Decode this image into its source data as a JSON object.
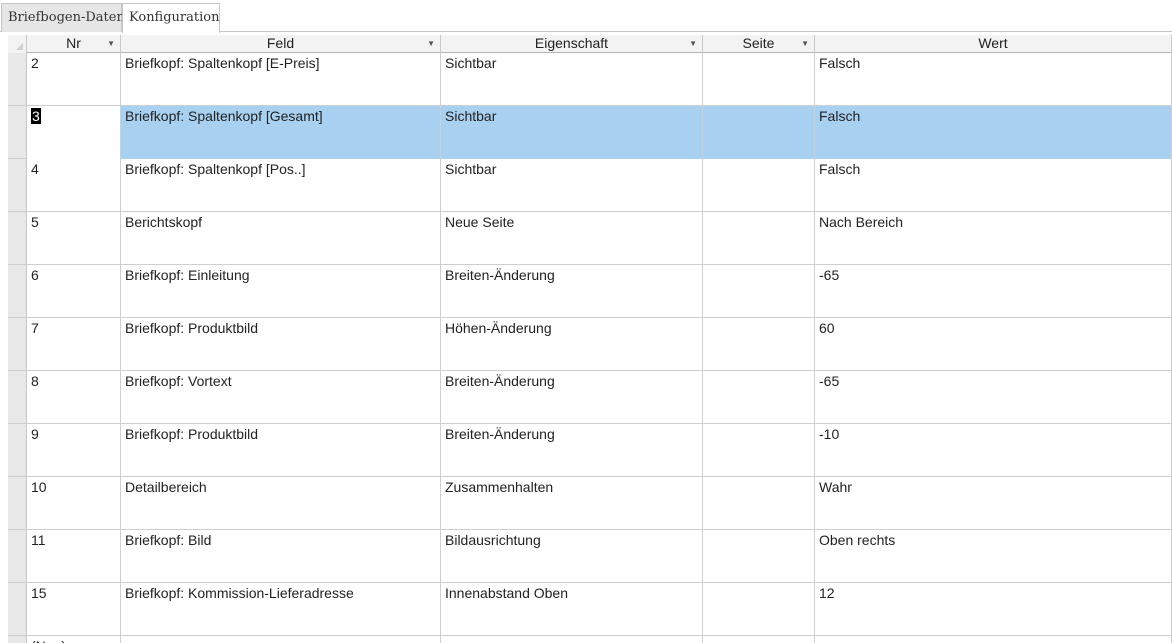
{
  "tabs": [
    {
      "label": "Briefbogen-Daten",
      "active": false
    },
    {
      "label": "Konfiguration",
      "active": true
    }
  ],
  "columns": {
    "nr": "Nr",
    "feld": "Feld",
    "eigenschaft": "Eigenschaft",
    "seite": "Seite",
    "wert": "Wert"
  },
  "rows": [
    {
      "nr": "2",
      "feld": "Briefkopf: Spaltenkopf [E-Preis]",
      "eigenschaft": "Sichtbar",
      "seite": "",
      "wert": "Falsch"
    },
    {
      "nr": "3",
      "feld": "Briefkopf: Spaltenkopf [Gesamt]",
      "eigenschaft": "Sichtbar",
      "seite": "",
      "wert": "Falsch",
      "selected": true
    },
    {
      "nr": "4",
      "feld": "Briefkopf: Spaltenkopf [Pos..]",
      "eigenschaft": "Sichtbar",
      "seite": "",
      "wert": "Falsch"
    },
    {
      "nr": "5",
      "feld": "Berichtskopf",
      "eigenschaft": "Neue Seite",
      "seite": "",
      "wert": "Nach Bereich"
    },
    {
      "nr": "6",
      "feld": "Briefkopf: Einleitung",
      "eigenschaft": "Breiten-Änderung",
      "seite": "",
      "wert": "-65"
    },
    {
      "nr": "7",
      "feld": "Briefkopf: Produktbild",
      "eigenschaft": "Höhen-Änderung",
      "seite": "",
      "wert": "60"
    },
    {
      "nr": "8",
      "feld": "Briefkopf: Vortext",
      "eigenschaft": "Breiten-Änderung",
      "seite": "",
      "wert": "-65"
    },
    {
      "nr": "9",
      "feld": "Briefkopf: Produktbild",
      "eigenschaft": "Breiten-Änderung",
      "seite": "",
      "wert": "-10"
    },
    {
      "nr": "10",
      "feld": "Detailbereich",
      "eigenschaft": "Zusammenhalten",
      "seite": "",
      "wert": "Wahr"
    },
    {
      "nr": "11",
      "feld": "Briefkopf: Bild",
      "eigenschaft": "Bildausrichtung",
      "seite": "",
      "wert": "Oben rechts"
    },
    {
      "nr": "15",
      "feld": "Briefkopf: Kommission-Lieferadresse",
      "eigenschaft": "Innenabstand Oben",
      "seite": "",
      "wert": "12"
    }
  ],
  "new_row_label": "(Neu)",
  "colors": {
    "selection": "#a8d0f0",
    "grid_line": "#cfcfcf",
    "header_bg": "#f3f3f3"
  }
}
